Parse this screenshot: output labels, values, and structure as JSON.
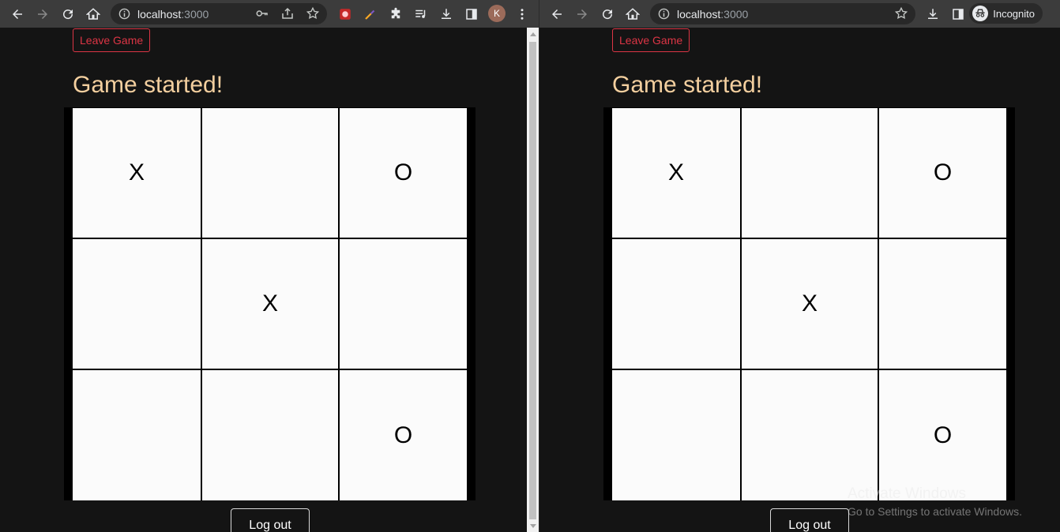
{
  "browser_left": {
    "url_host": "localhost",
    "url_port": ":3000",
    "avatar_initial": "K"
  },
  "browser_right": {
    "url_host": "localhost",
    "url_port": ":3000",
    "incognito_label": "Incognito"
  },
  "game": {
    "leave_button": "Leave Game",
    "title": "Game started!",
    "board": [
      "X",
      "",
      "O",
      "",
      "X",
      "",
      "",
      "",
      "O"
    ],
    "logout_button": "Log out"
  },
  "watermark": {
    "line1": "Activate Windows",
    "line2": "Go to Settings to activate Windows."
  },
  "colors": {
    "background": "#141414",
    "title": "#f3cf9f",
    "leave_button": "#dc3545",
    "cell": "#fbfbfb"
  }
}
